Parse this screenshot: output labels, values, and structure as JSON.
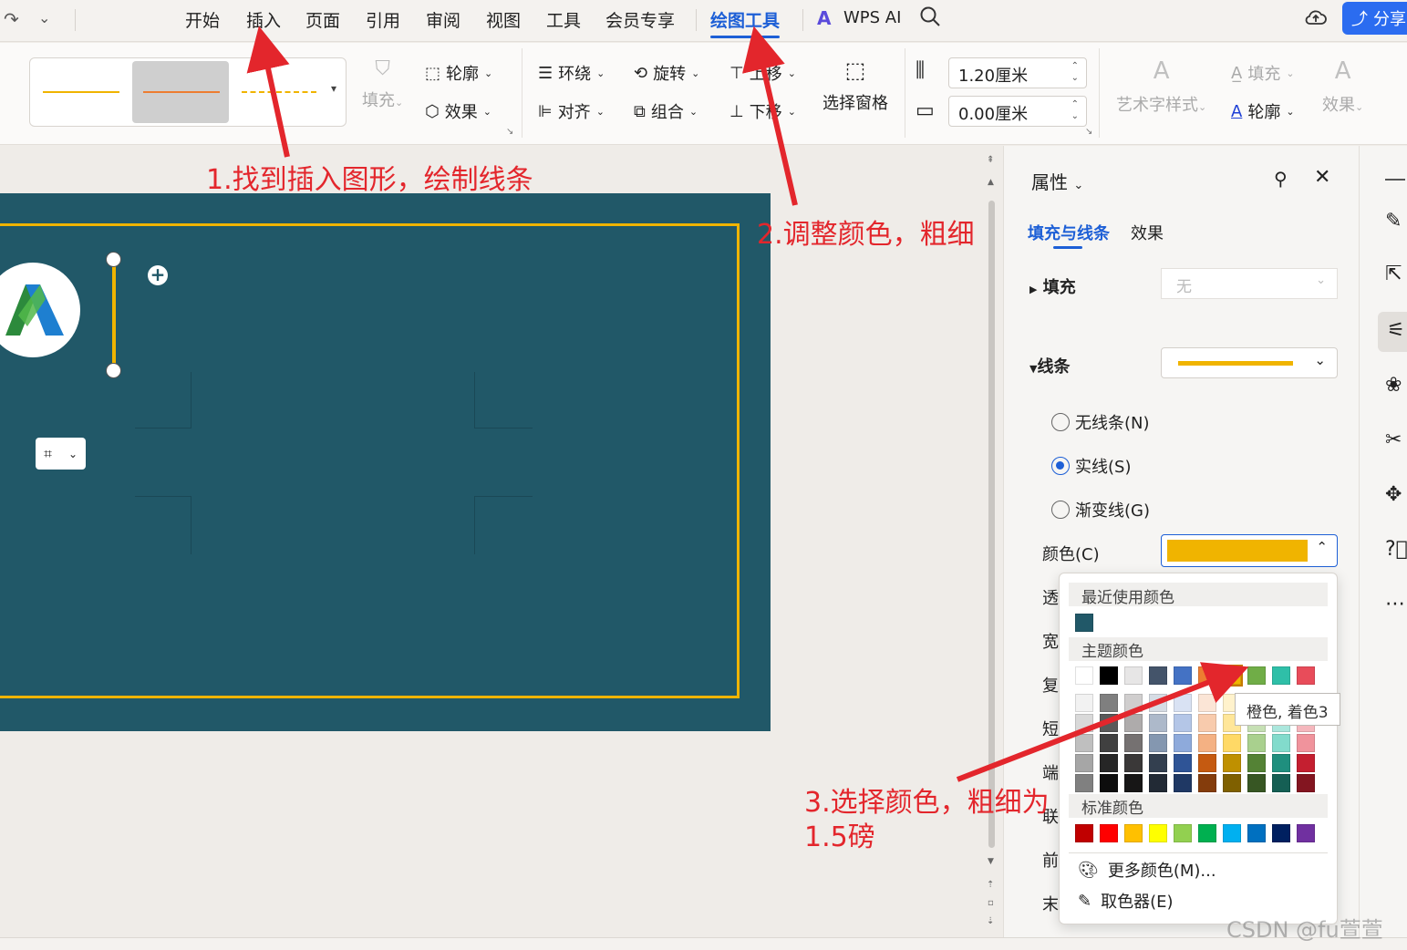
{
  "menu": {
    "items": [
      "开始",
      "插入",
      "页面",
      "引用",
      "审阅",
      "视图",
      "工具",
      "会员专享"
    ],
    "active": "绘图工具",
    "wps_ai": "WPS AI",
    "share": "分享"
  },
  "ribbon": {
    "fill": "填充",
    "outline": "轮廓",
    "effect": "效果",
    "wrap": "环绕",
    "rotate": "旋转",
    "move_up": "上移",
    "align": "对齐",
    "group": "组合",
    "move_down": "下移",
    "select_pane": "选择窗格",
    "height_value": "1.20厘米",
    "width_value": "0.00厘米",
    "art_style": "艺术字样式",
    "text_fill": "填充",
    "text_outline": "轮廓",
    "text_effect": "效果"
  },
  "panel": {
    "title": "属性",
    "tab_fill_line": "填充与线条",
    "tab_effect": "效果",
    "fill_label": "填充",
    "fill_value": "无",
    "line_label": "线条",
    "radio_none": "无线条(N)",
    "radio_solid": "实线(S)",
    "radio_gradient": "渐变线(G)",
    "color_label": "颜色(C)",
    "truncated_labels": [
      "透",
      "宽",
      "复",
      "短",
      "端",
      "联",
      "前",
      "末"
    ]
  },
  "color_picker": {
    "recent_title": "最近使用颜色",
    "theme_title": "主题颜色",
    "standard_title": "标准颜色",
    "more_colors": "更多颜色(M)...",
    "eyedropper": "取色器(E)",
    "tooltip": "橙色, 着色3",
    "recent_colors": [
      "#215868"
    ],
    "theme_row": [
      "#ffffff",
      "#000000",
      "#e7e6e6",
      "#44546a",
      "#4472c4",
      "#ed7d31",
      "#f0b400",
      "#70ad47",
      "#2fbfa8",
      "#e84c5a"
    ],
    "theme_shades": [
      [
        "#f2f2f2",
        "#d9d9d9",
        "#bfbfbf",
        "#a6a6a6",
        "#808080"
      ],
      [
        "#7f7f7f",
        "#595959",
        "#404040",
        "#262626",
        "#0d0d0d"
      ],
      [
        "#d0cece",
        "#aeabab",
        "#757171",
        "#3a3838",
        "#171616"
      ],
      [
        "#d6dce4",
        "#adb9ca",
        "#8497b0",
        "#333f4f",
        "#222a35"
      ],
      [
        "#d9e2f3",
        "#b4c6e7",
        "#8eaadb",
        "#2f5496",
        "#1f3864"
      ],
      [
        "#fbe5d6",
        "#f8cbad",
        "#f4b183",
        "#c55a11",
        "#843c0c"
      ],
      [
        "#fff2cc",
        "#ffe699",
        "#ffd966",
        "#bf9000",
        "#7f6000"
      ],
      [
        "#e2efda",
        "#c6e0b4",
        "#a9d08e",
        "#548235",
        "#375623"
      ],
      [
        "#d5f3ee",
        "#abe7dd",
        "#82dbcc",
        "#1f8f7e",
        "#155f54"
      ],
      [
        "#fadbde",
        "#f5b7bd",
        "#f0939c",
        "#c41f30",
        "#831520"
      ]
    ],
    "standard_colors": [
      "#c00000",
      "#ff0000",
      "#ffc000",
      "#ffff00",
      "#92d050",
      "#00b050",
      "#00b0f0",
      "#0070c0",
      "#002060",
      "#7030a0"
    ]
  },
  "annotations": {
    "step1": "1.找到插入图形，绘制线条",
    "step2": "2.调整颜色，粗细",
    "step3_line1": "3.选择颜色，粗细为",
    "step3_line2": "1.5磅"
  },
  "watermark": "CSDN @fu萱萱",
  "colors": {
    "slide_bg": "#215868",
    "accent_line": "#f0b400",
    "annotation": "#e3262c",
    "active_tab": "#1d5fd6"
  }
}
